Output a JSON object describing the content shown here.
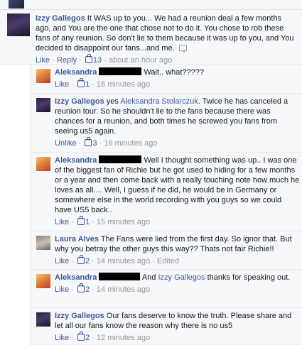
{
  "meta": {
    "like": "Like",
    "reply": "Reply",
    "unlike": "Unlike",
    "sep": "·",
    "edited": "Edited"
  },
  "main_comment": {
    "author": "Izzy Gallegos",
    "text": "It WAS up to you... We had a reunion deal a few months ago, and You are the one that chose not to do it. You chose to rob these fans of any reunion. So don't lie to them because it was up to you, and You decided to disappoint our fans...and me.",
    "likes": "13",
    "time": "about an hour ago"
  },
  "replies": [
    {
      "author": "Aleksandra",
      "text": "Wait.. what?????",
      "likes": "1",
      "time": "18 minutes ago"
    },
    {
      "author": "Izzy Gallegos",
      "text_before": "yes",
      "tag": "Aleksandra Stolarczuk",
      "text_after": ". Twice he has canceled a reunion tour. So he shouldn't lie to the fans because there was chances for a reunion, and both times he screwed you fans from seeing us5 again.",
      "likes": "3",
      "time": "16 minutes ago"
    },
    {
      "author": "Aleksandra",
      "text": "Well I thought something was up.. I was one of the biggest fan of Richie but he got used to hiding for a few months or a year and then come back with a really touching note how much he loves as all.... Well, I guess if he did, he would be in Germany or somewhere else in the world recording with you guys so we could have US5 back..",
      "likes": "1",
      "time": "15 minutes ago"
    },
    {
      "author": "Laura Alves",
      "text": "The Fans were lied from the first day. So ignor that. But why you betray the other guys this way?? Thats not fair Richie!!",
      "likes": "2",
      "time": "14 minutes ago"
    },
    {
      "author": "Aleksandra",
      "text_before": "And",
      "tag": "Izzy Gallegos",
      "text_after": "thanks for speaking out.",
      "likes": "2",
      "time": "14 minutes ago"
    },
    {
      "author": "Izzy Gallegos",
      "text": "Our fans deserve to know the truth. Please share and let all our fans know the reason why there is no us5",
      "likes": "2",
      "time": "12 minutes ago"
    }
  ]
}
